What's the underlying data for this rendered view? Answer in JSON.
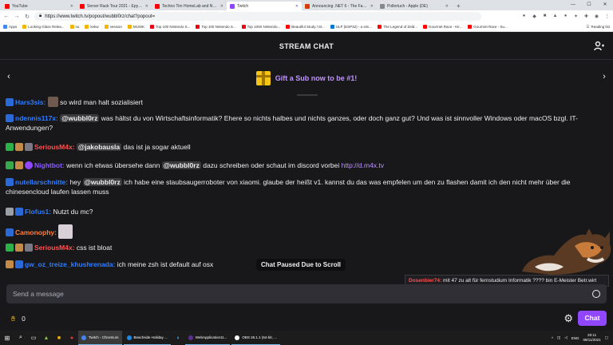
{
  "browser": {
    "tabs": [
      {
        "label": "YouTube",
        "color": "#ff0000",
        "active": false
      },
      {
        "label": "Server Rack Tour 2021 - Epyc Ryz...",
        "color": "#ff0000",
        "active": false
      },
      {
        "label": "Techno Tim HomeLab and NEW S...",
        "color": "#ff0000",
        "active": false
      },
      {
        "label": "Twitch",
        "color": "#9147ff",
        "active": true
      },
      {
        "label": "Announcing .NET 6 - The Fastest...",
        "color": "#d83b01",
        "active": false
      },
      {
        "label": "Pollertuch - Apple (DE)",
        "color": "#888888",
        "active": false
      }
    ],
    "url": "https://www.twitch.tv/popout/wubbl0rz/chat?popout=",
    "bookmarks": [
      {
        "label": "Apps",
        "color": "#4285f4"
      },
      {
        "label": "Looking Glass Relea...",
        "color": "#f4b400"
      },
      {
        "label": "so",
        "color": "#f4b400"
      },
      {
        "label": "kekw",
        "color": "#f4b400"
      },
      {
        "label": "session",
        "color": "#f4b400"
      },
      {
        "label": "MUSIK",
        "color": "#f4b400"
      },
      {
        "label": "Top 100 Nintendo S...",
        "color": "#e60012"
      },
      {
        "label": "Top 100 Nintendo S...",
        "color": "#e60012"
      },
      {
        "label": "Top 1000 Nintendo...",
        "color": "#e60012"
      },
      {
        "label": "Beautiful Study / M...",
        "color": "#ff0000"
      },
      {
        "label": "ULP (ESP32) - a sim...",
        "color": "#0078d4"
      },
      {
        "label": "The Legend of Zeld...",
        "color": "#ff0000"
      },
      {
        "label": "Gourmet Race - Kir...",
        "color": "#ff0000"
      },
      {
        "label": "Gourmet Race - Su...",
        "color": "#ff0000"
      }
    ],
    "reading_list": "Reading list"
  },
  "chat": {
    "title": "STREAM CHAT",
    "gift_banner": "Gift a Sub now to be #1!",
    "paused_notice": "Chat Paused Due to Scroll",
    "input_placeholder": "Send a message",
    "points": "0",
    "chat_button": "Chat",
    "messages": [
      {
        "user": "Hars3sis:",
        "color": "#2e7dff",
        "pre": "",
        "mention": "",
        "text": "so wird man halt sozialisiert",
        "link": ""
      },
      {
        "user": "ndennis117x:",
        "color": "#2e7dff",
        "pre": "",
        "mention": "@wubbl0rz",
        "text": "was hältst du von Wirtschaftsinformatik? Ehere so nichts halbes und nichts ganzes, oder doch ganz gut? Und was ist sinnvoller Windows oder macOS bzgl. IT-Anwendungen?",
        "link": ""
      },
      {
        "user": "SeriousM4x:",
        "color": "#ff4f4f",
        "pre": "",
        "mention": "@jakobausla",
        "text": "das ist ja sogar aktuell",
        "link": ""
      },
      {
        "user": "Nightbot:",
        "color": "#8a5cff",
        "pre": "wenn ich etwas übersehe dann",
        "mention": "@wubbl0rz",
        "text": "dazu schreiben oder schaut im discord vorbei",
        "link": "http://d.m4x.tv"
      },
      {
        "user": "nutellarschnitte:",
        "color": "#2e7dff",
        "pre": "hey",
        "mention": "@wubbl0rz",
        "text": "ich habe eine staubsaugerroboter von xiaomi. glaube der heißt v1. kannst du das was empfelen um den zu flashen damit ich den nicht mehr über die chinesencloud laufen lassen muss",
        "link": ""
      },
      {
        "user": "Flofus1:",
        "color": "#2e7dff",
        "pre": "",
        "mention": "",
        "text": "Nutzt du mc?",
        "link": ""
      },
      {
        "user": "Camonophy:",
        "color": "#ff7f3f",
        "pre": "",
        "mention": "",
        "text": "",
        "link": ""
      },
      {
        "user": "SeriousM4x:",
        "color": "#ff4f4f",
        "pre": "",
        "mention": "",
        "text": "css ist bloat",
        "link": ""
      },
      {
        "user": "gw_oz_treize_khushrenada:",
        "color": "#2e7dff",
        "pre": "",
        "mention": "",
        "text": "ich meine zsh ist default auf osx",
        "link": ""
      }
    ]
  },
  "overlay": {
    "user": "Dosenbier74:",
    "text": "mit 47 zu alt für fernstudium Informatik ???? bin E-Meister Betr.wirt"
  },
  "taskbar": {
    "apps": [
      {
        "label": "Twitch - Chromium",
        "color": "#4285f4",
        "active": true
      },
      {
        "label": "Beachside Holiday ...",
        "color": "#1e88e5",
        "active": false
      },
      {
        "label": "WebApplication11...",
        "color": "#5c2d91",
        "active": false
      },
      {
        "label": "OBS 26.1.1 (64-bit, ...",
        "color": "#ffffff",
        "active": false
      }
    ],
    "lang": "ENG",
    "time": "20:11",
    "date": "08/11/2021"
  },
  "colors": {
    "accent": "#9147ff",
    "background": "#18181b",
    "link": "#bf94ff"
  }
}
